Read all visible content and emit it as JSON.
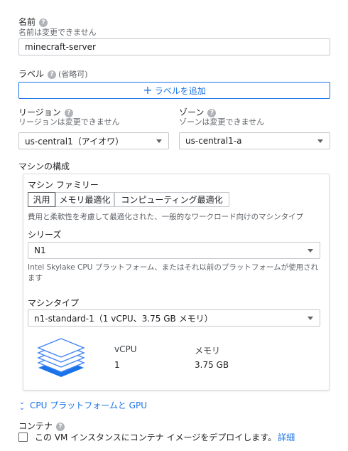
{
  "name": {
    "label": "名前",
    "sub": "名前は変更できません",
    "value": "minecraft-server"
  },
  "labels": {
    "label": "ラベル",
    "optional": "(省略可)",
    "add_button": "ラベルを追加"
  },
  "region": {
    "label": "リージョン",
    "sub": "リージョンは変更できません",
    "value": "us-central1（アイオワ）"
  },
  "zone": {
    "label": "ゾーン",
    "sub": "ゾーンは変更できません",
    "value": "us-central1-a"
  },
  "machine_config": {
    "title": "マシンの構成",
    "family_label": "マシン ファミリー",
    "tabs": [
      "汎用",
      "メモリ最適化",
      "コンピューティング最適化"
    ],
    "active_tab": "汎用",
    "family_desc": "費用と柔軟性を考慮して最適化された、一般的なワークロード向けのマシンタイプ",
    "series_label": "シリーズ",
    "series_value": "N1",
    "series_desc": "Intel Skylake CPU プラットフォーム、またはそれ以前のプラットフォームが使用されます",
    "type_label": "マシンタイプ",
    "type_value": "n1-standard-1（1 vCPU、3.75 GB メモリ）",
    "vcpu_header": "vCPU",
    "memory_header": "メモリ",
    "vcpu_value": "1",
    "memory_value": "3.75 GB"
  },
  "cpu_gpu_link": "CPU プラットフォームと GPU",
  "container": {
    "label": "コンテナ",
    "checkbox_text": "この VM インスタンスにコンテナ イメージをデプロイします。",
    "details_link": "詳細"
  },
  "colors": {
    "accent": "#1a73e8",
    "icon_blue": "#4285f4"
  }
}
